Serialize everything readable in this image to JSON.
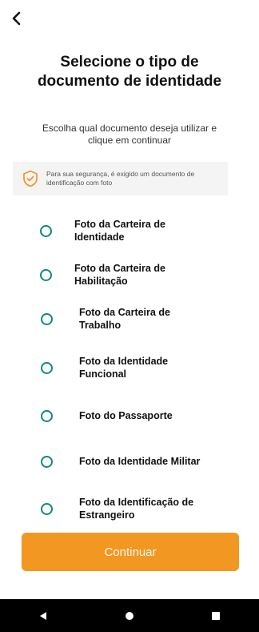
{
  "header": {
    "back_icon": "back-arrow-icon"
  },
  "title": "Selecione o tipo de documento de identidade",
  "subtitle": "Escolha qual documento deseja utilizar e clique em continuar",
  "notice": {
    "icon": "shield-check-icon",
    "text": "Para sua segurança, é exigido um documento de identificação com foto"
  },
  "options": [
    {
      "label": "Foto da Carteira de Identidade"
    },
    {
      "label": "Foto da Carteira de Habilitação"
    },
    {
      "label": "Foto da Carteira de Trabalho"
    },
    {
      "label": "Foto da Identidade Funcional"
    },
    {
      "label": "Foto do Passaporte"
    },
    {
      "label": "Foto da Identidade Militar"
    },
    {
      "label": "Foto da Identificação de Estrangeiro"
    }
  ],
  "continue_label": "Continuar",
  "colors": {
    "accent": "#f29722",
    "radio": "#0f8a76"
  },
  "system_nav": {
    "back": "nav-back-icon",
    "home": "nav-home-icon",
    "recents": "nav-recents-icon"
  }
}
